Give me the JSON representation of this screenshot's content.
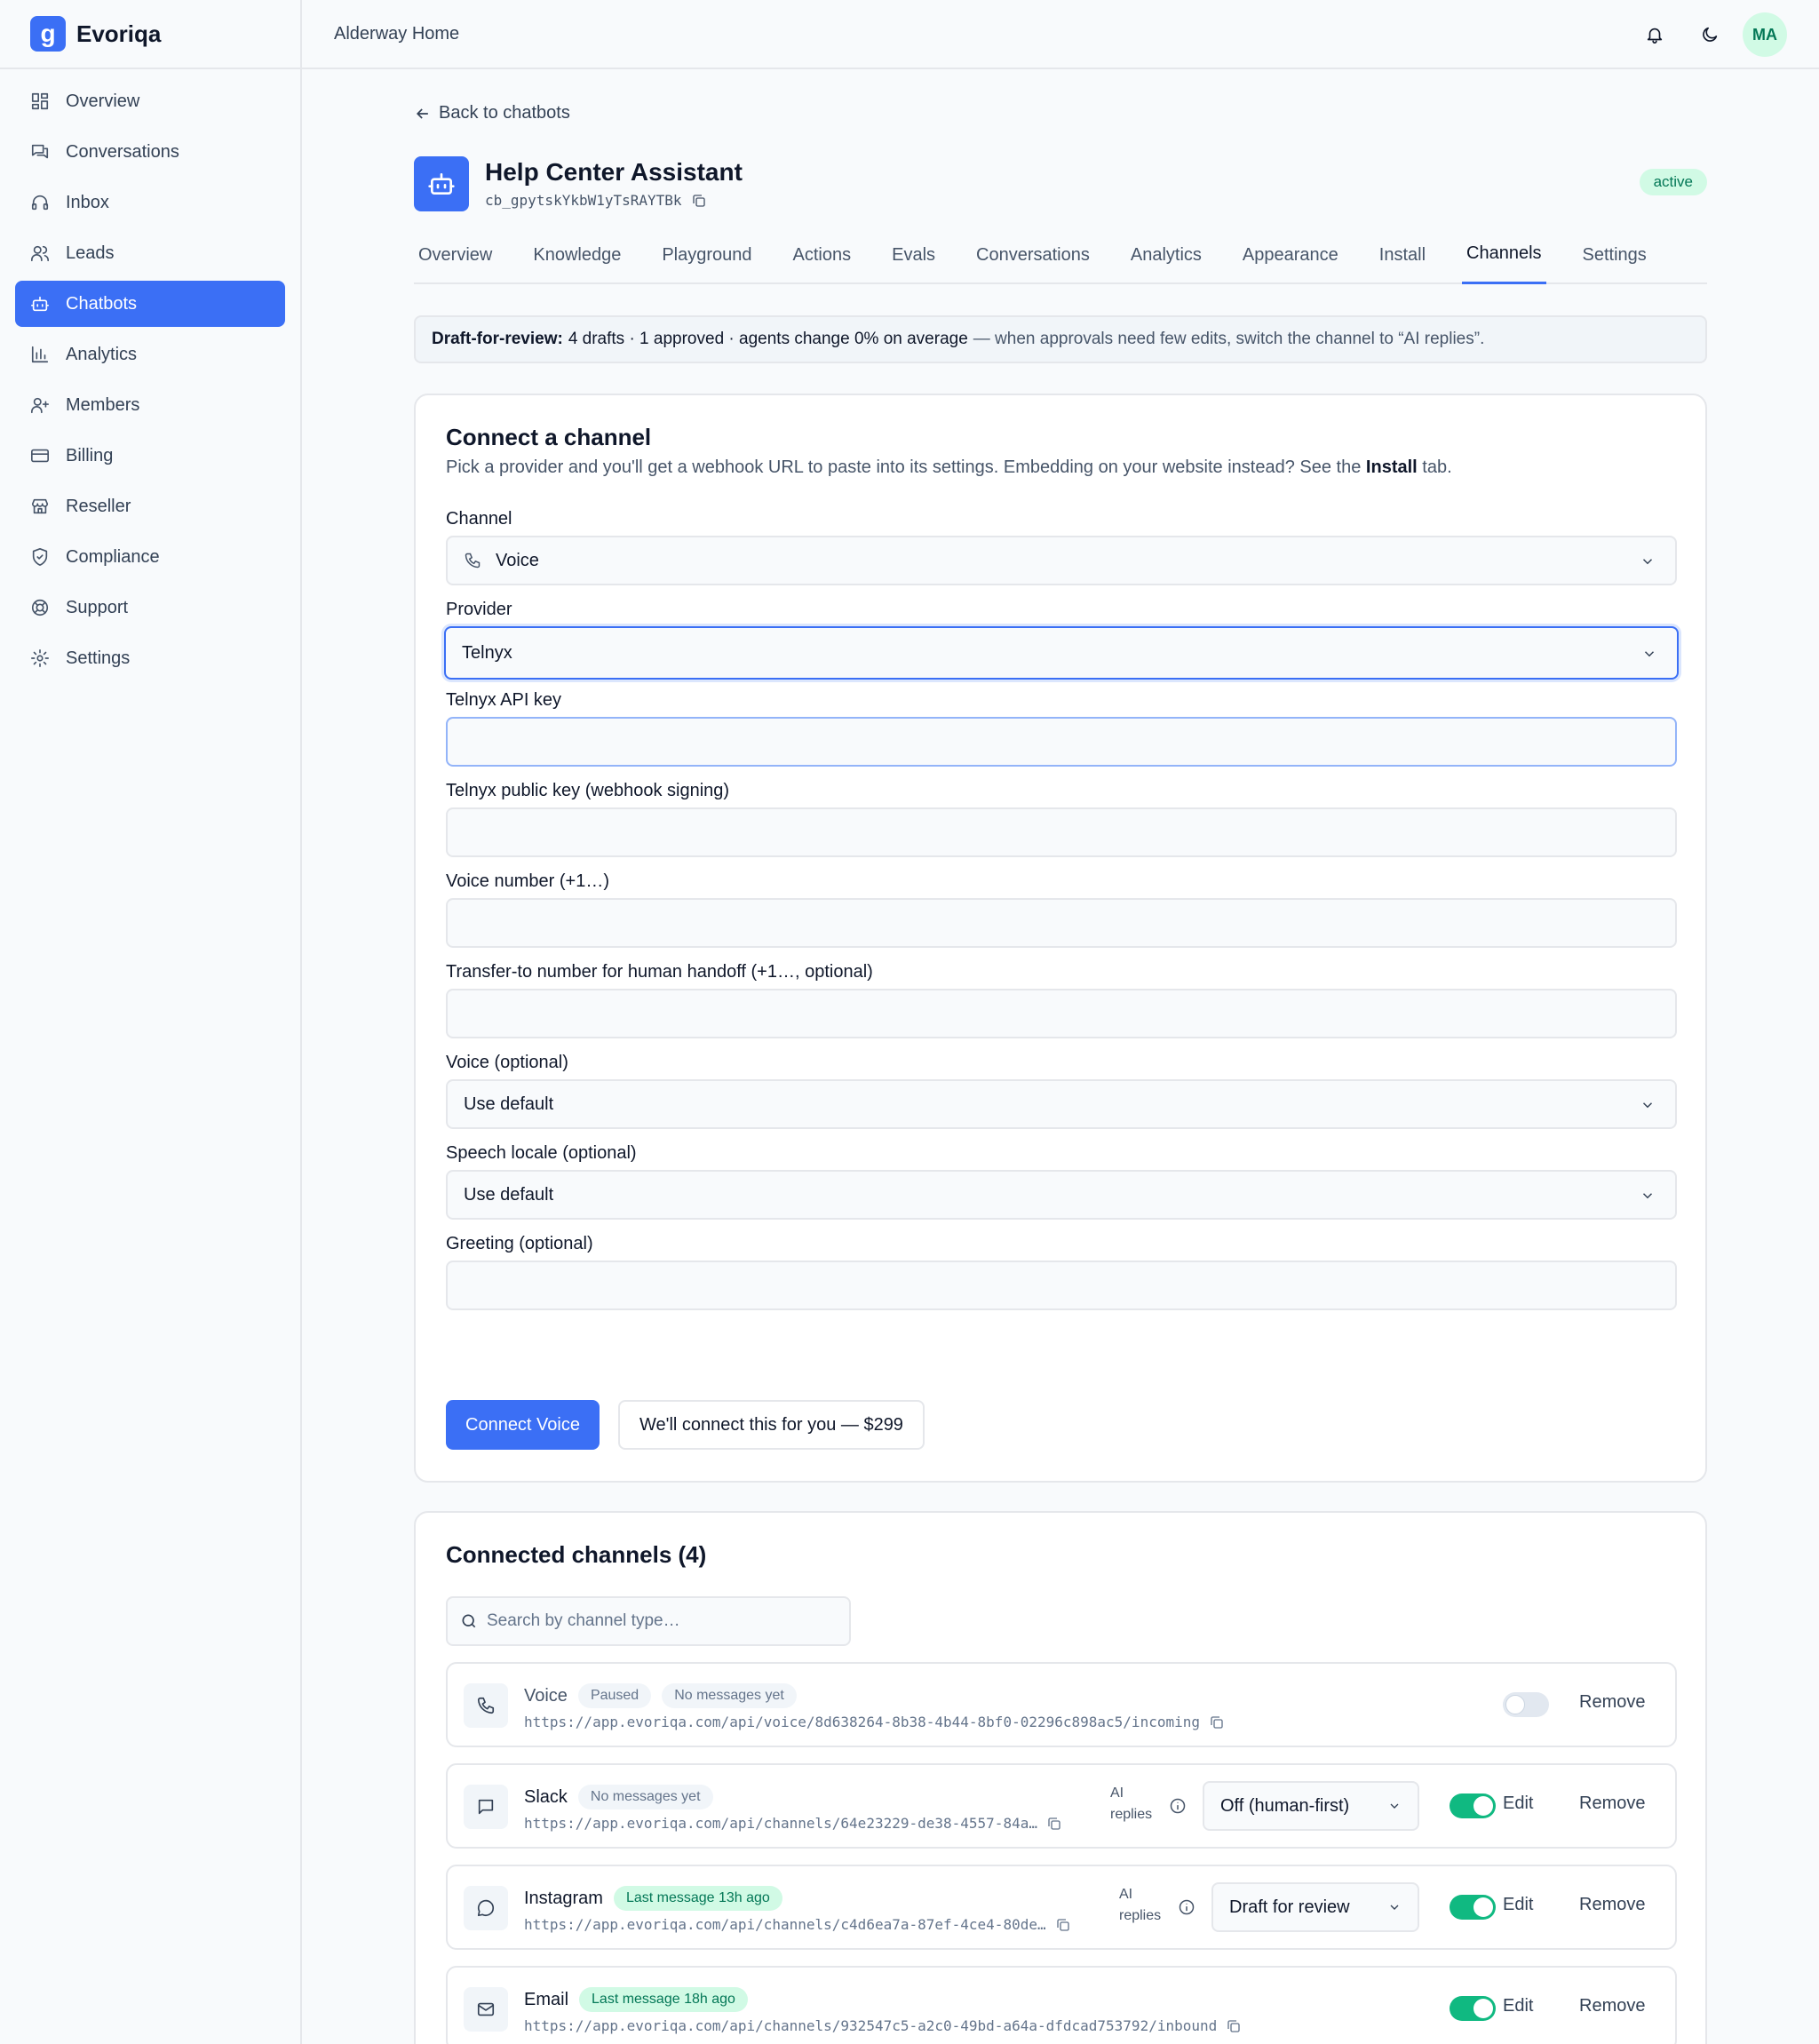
{
  "brand": {
    "logo_letter": "g",
    "name": "Evoriqa"
  },
  "workspace": "Alderway Home",
  "user": {
    "initials": "MA"
  },
  "sidebar": {
    "items": [
      {
        "label": "Overview",
        "icon": "grid-icon"
      },
      {
        "label": "Conversations",
        "icon": "chat-icon"
      },
      {
        "label": "Inbox",
        "icon": "headset-icon"
      },
      {
        "label": "Leads",
        "icon": "users-icon"
      },
      {
        "label": "Chatbots",
        "icon": "bot-icon",
        "active": true
      },
      {
        "label": "Analytics",
        "icon": "bar-chart-icon"
      },
      {
        "label": "Members",
        "icon": "user-plus-icon"
      },
      {
        "label": "Billing",
        "icon": "card-icon"
      },
      {
        "label": "Reseller",
        "icon": "store-icon"
      },
      {
        "label": "Compliance",
        "icon": "shield-icon"
      },
      {
        "label": "Support",
        "icon": "lifebuoy-icon"
      },
      {
        "label": "Settings",
        "icon": "gear-icon"
      }
    ]
  },
  "back_link": "Back to chatbots",
  "bot": {
    "title": "Help Center Assistant",
    "id": "cb_gpytskYkbW1yTsRAYTBk",
    "status": "active"
  },
  "tabs": [
    "Overview",
    "Knowledge",
    "Playground",
    "Actions",
    "Evals",
    "Conversations",
    "Analytics",
    "Appearance",
    "Install",
    "Channels",
    "Settings"
  ],
  "active_tab": "Channels",
  "notice": {
    "label": "Draft-for-review:",
    "stats": "4 drafts · 1 approved · agents change 0% on average",
    "hint": "— when approvals need few edits, switch the channel to “AI replies”."
  },
  "connect": {
    "title": "Connect a channel",
    "desc_pre": "Pick a provider and you'll get a webhook URL to paste into its settings. Embedding on your website instead? See the ",
    "desc_link": "Install",
    "desc_post": " tab.",
    "fields": {
      "channel_label": "Channel",
      "channel_value": "Voice",
      "provider_label": "Provider",
      "provider_value": "Telnyx",
      "api_key_label": "Telnyx API key",
      "api_key_value": "",
      "public_key_label": "Telnyx public key (webhook signing)",
      "public_key_value": "",
      "voice_number_label": "Voice number (+1…)",
      "voice_number_value": "",
      "transfer_label": "Transfer-to number for human handoff (+1…, optional)",
      "transfer_value": "",
      "voice_label": "Voice (optional)",
      "voice_value": "Use default",
      "locale_label": "Speech locale (optional)",
      "locale_value": "Use default",
      "greeting_label": "Greeting (optional)",
      "greeting_value": ""
    },
    "primary_button": "Connect Voice",
    "secondary_button": "We'll connect this for you — $299"
  },
  "connected": {
    "title": "Connected channels (4)",
    "search_placeholder": "Search by channel type…",
    "ai_label_1": "AI",
    "ai_label_2": "replies",
    "edit_label": "Edit",
    "remove_label": "Remove",
    "rows": [
      {
        "name": "Voice",
        "badges": [
          "Paused",
          "No messages yet"
        ],
        "url": "https://app.evoriqa.com/api/voice/8d638264-8b38-4b44-8bf0-02296c898ac5/incoming",
        "enabled": false
      },
      {
        "name": "Slack",
        "badges": [
          "No messages yet"
        ],
        "url": "https://app.evoriqa.com/api/channels/64e23229-de38-4557-84a…",
        "mode": "Off (human-first)",
        "enabled": true
      },
      {
        "name": "Instagram",
        "badges": [
          "Last message 13h ago"
        ],
        "url": "https://app.evoriqa.com/api/channels/c4d6ea7a-87ef-4ce4-80de…",
        "mode": "Draft for review",
        "enabled": true
      },
      {
        "name": "Email",
        "badges": [
          "Last message 18h ago"
        ],
        "url": "https://app.evoriqa.com/api/channels/932547c5-a2c0-49bd-a64a-dfdcad753792/inbound",
        "enabled": true
      }
    ]
  },
  "colors": {
    "accent": "#3b6ff5",
    "success": "#10b981",
    "badge_green_bg": "#d1fae5"
  }
}
